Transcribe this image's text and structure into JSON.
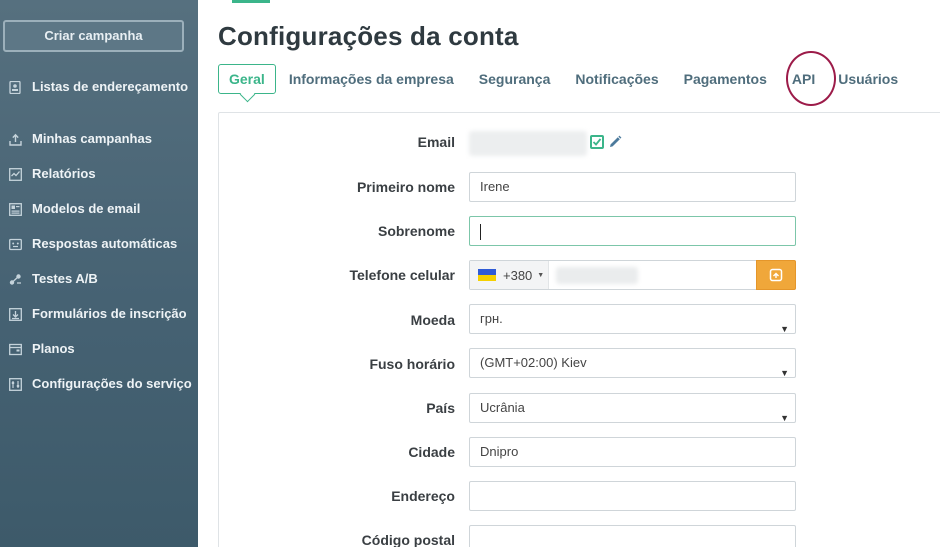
{
  "sidebar": {
    "create_button": "Criar campanha",
    "items": [
      {
        "label": "Listas de endereçamento",
        "icon": "address-book-icon"
      },
      {
        "label": "Minhas campanhas",
        "icon": "send-icon"
      },
      {
        "label": "Relatórios",
        "icon": "chart-icon"
      },
      {
        "label": "Modelos de email",
        "icon": "template-icon"
      },
      {
        "label": "Respostas automáticas",
        "icon": "autoresponder-icon"
      },
      {
        "label": "Testes A/B",
        "icon": "ab-test-icon"
      },
      {
        "label": "Formulários de inscrição",
        "icon": "form-icon"
      },
      {
        "label": "Planos",
        "icon": "wallet-icon"
      },
      {
        "label": "Configurações do serviço",
        "icon": "sliders-icon"
      }
    ]
  },
  "page": {
    "title": "Configurações da conta",
    "tabs": [
      "Geral",
      "Informações da empresa",
      "Segurança",
      "Notificações",
      "Pagamentos",
      "API",
      "Usuários"
    ],
    "active_tab": "Geral",
    "highlighted_tab": "API"
  },
  "form": {
    "email_label": "Email",
    "first_name_label": "Primeiro nome",
    "first_name_value": "Irene",
    "last_name_label": "Sobrenome",
    "last_name_value": "",
    "phone_label": "Telefone celular",
    "phone_prefix": "+380",
    "currency_label": "Moeda",
    "currency_value": "грн.",
    "timezone_label": "Fuso horário",
    "timezone_value": "(GMT+02:00) Kiev",
    "country_label": "País",
    "country_value": "Ucrânia",
    "city_label": "Cidade",
    "city_value": "Dnipro",
    "address_label": "Endereço",
    "address_value": "",
    "postal_label": "Código postal",
    "postal_value": ""
  },
  "colors": {
    "accent": "#3bb58a",
    "sidebar": "#466273",
    "highlight_ring": "#9c1b49",
    "phone_button": "#f0a73a"
  }
}
